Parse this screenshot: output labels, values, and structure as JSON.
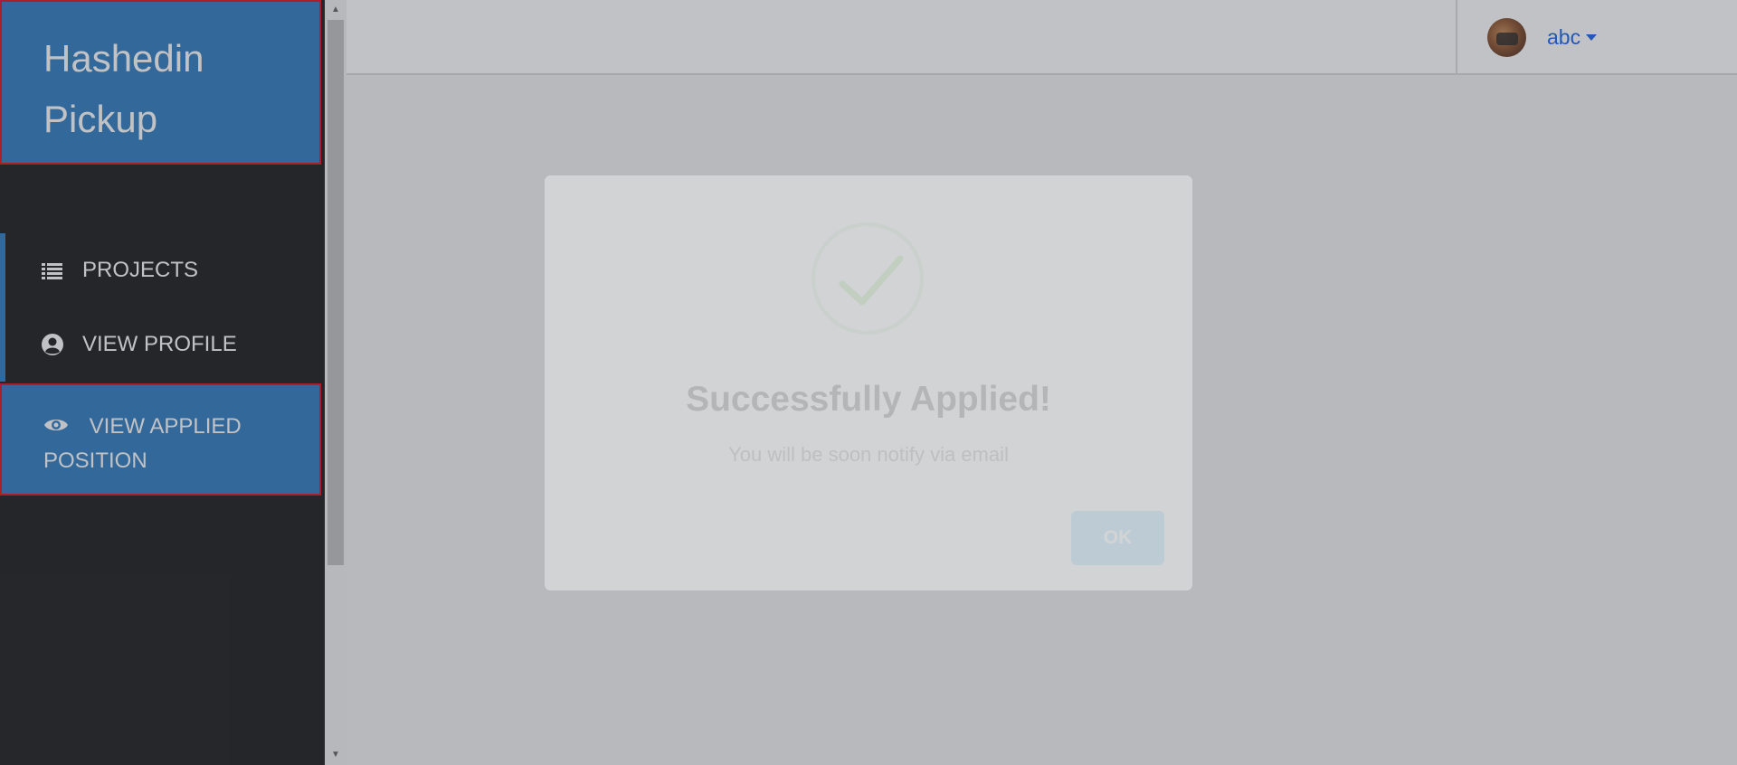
{
  "brand": {
    "line1": "Hashedin",
    "line2": "Pickup"
  },
  "sidebar": {
    "items": [
      {
        "label": "PROJECTS",
        "icon": "list-icon"
      },
      {
        "label": "VIEW PROFILE",
        "icon": "user-circle-icon"
      },
      {
        "label": "VIEW APPLIED POSITION",
        "icon": "eye-icon"
      }
    ]
  },
  "header": {
    "username": "abc"
  },
  "modal": {
    "title": "Successfully Applied!",
    "text": "You will be soon notify via email",
    "ok_label": "OK"
  },
  "colors": {
    "accent": "#2e7bc0",
    "highlight_border": "#e0101a",
    "sidebar_bg": "#1a1a1a",
    "link": "#1a62ea",
    "ok_button": "#8cd4f5"
  }
}
